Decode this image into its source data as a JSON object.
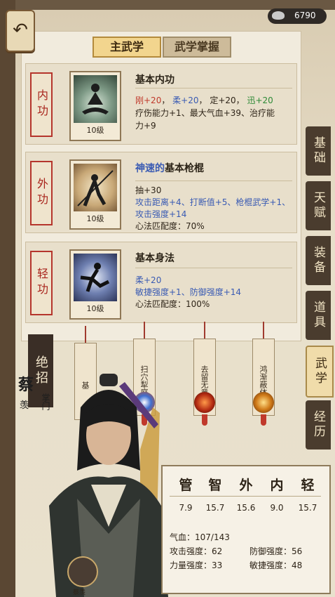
{
  "currency": {
    "value": "6790"
  },
  "tabs": {
    "main": "主武学",
    "master": "武学掌握"
  },
  "skills": [
    {
      "category": "内功",
      "name": "基本内功",
      "level": "10级",
      "line1": [
        {
          "t": "刚+20",
          "c": "red"
        },
        {
          "t": "柔+20",
          "c": "blue"
        },
        {
          "t": "定+20",
          "c": "plain"
        },
        {
          "t": "迅+20",
          "c": "green"
        }
      ],
      "line2": "疗伤能力+1、最大气血+39、治疗能",
      "line3": "力+9"
    },
    {
      "category": "外功",
      "prefix": "神速的",
      "name": "基本枪棍",
      "level": "10级",
      "line1": "抽+30",
      "line2a": "攻击距离+4、",
      "line2b": "打断值+5、",
      "line2c": "枪棍武学+1、",
      "line3": "攻击强度+14",
      "line4": "心法匹配度：70%"
    },
    {
      "category": "轻功",
      "name": "基本身法",
      "level": "10级",
      "line1": "柔+20",
      "line2a": "敏捷强度+1、",
      "line2b": "防御强度+14",
      "line3": "心法匹配度：100%"
    }
  ],
  "right_menu": [
    "基础",
    "天赋",
    "装备",
    "道具",
    "武学",
    "经历"
  ],
  "ultimate": {
    "label": "绝招"
  },
  "hanging_skills": [
    "基",
    "扫穴犁庭",
    "去留无意",
    "鸿渐蔽体"
  ],
  "character": {
    "name": "蔡",
    "sub1": "羡",
    "sub2": "掌门",
    "avatar_label": "蔡羡"
  },
  "attributes": {
    "headers": [
      "管",
      "智",
      "外",
      "内",
      "轻"
    ],
    "values": [
      "7.9",
      "15.7",
      "15.6",
      "9.0",
      "15.7"
    ]
  },
  "stats": {
    "hp": "气血：107/143",
    "attack": "攻击强度：62",
    "defense": "防御强度：56",
    "power": "力量强度：33",
    "agility": "敏捷强度：48"
  }
}
